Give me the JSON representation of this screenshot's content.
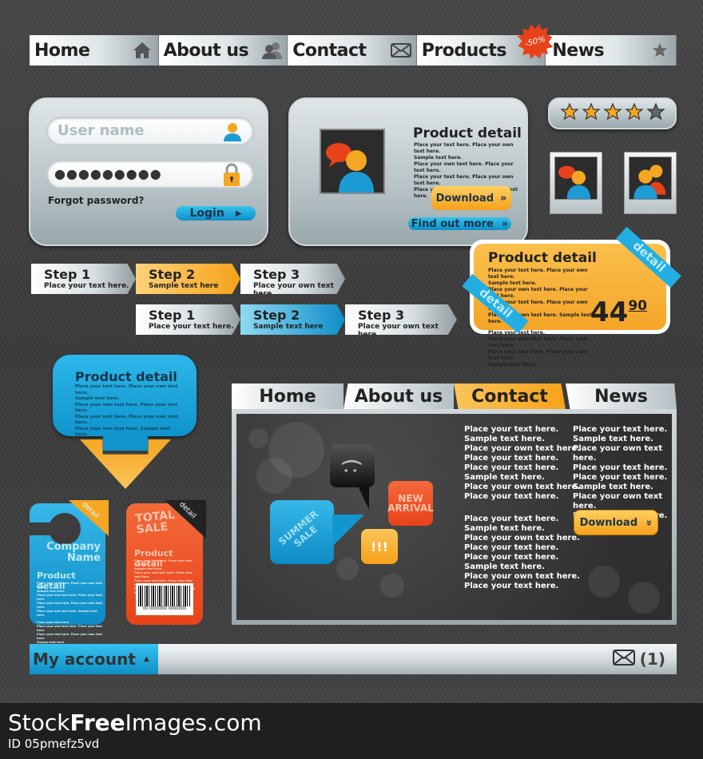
{
  "top_nav": {
    "tabs": [
      {
        "label": "Home",
        "icon": "home-icon"
      },
      {
        "label": "About us",
        "icon": "users-icon"
      },
      {
        "label": "Contact",
        "icon": "envelope-icon"
      },
      {
        "label": "Products",
        "icon": "none"
      },
      {
        "label": "News",
        "icon": "star-icon"
      }
    ],
    "badge": "-50%"
  },
  "login": {
    "username_placeholder": "User name",
    "password_mask": "●●●●●●●●●",
    "forgot_password": "Forgot password?",
    "login_button": "Login"
  },
  "product_card": {
    "title": "Product detail",
    "text_lines": [
      "Place your  text here. Place your own text here.",
      "Sample text here.",
      "Place your own text here. Place your  text here.",
      "Place your  text here. Place your own text here.",
      "Place your own text here. Sample text here."
    ],
    "download_button": "Download",
    "find_out_more_button": "Find out more"
  },
  "rating": {
    "value": 4,
    "max": 5
  },
  "steps_orange": [
    {
      "title": "Step 1",
      "subtitle": "Place your  text here."
    },
    {
      "title": "Step 2",
      "subtitle": "Sample text here"
    },
    {
      "title": "Step 3",
      "subtitle": "Place your own text here."
    }
  ],
  "steps_blue": [
    {
      "title": "Step 1",
      "subtitle": "Place your  text here."
    },
    {
      "title": "Step 2",
      "subtitle": "Sample text here"
    },
    {
      "title": "Step 3",
      "subtitle": "Place your own text here."
    }
  ],
  "price_card": {
    "title": "Product detail",
    "text_lines": [
      "Place your  text here. Place your own text here.",
      "Sample text here.",
      "Place your own text here. Place your  text here.",
      "Place your  text here. Place your own text here.",
      "Place your own text here. Sample text here."
    ],
    "text_lines_2": [
      "Place your  text here.",
      "Place your own text here. Place your  text here.",
      "Place your  text here. Place your own text here.",
      "Sample text here."
    ],
    "price_main": "44",
    "price_cents": "90",
    "ribbon_label": "detail"
  },
  "blue_bubble": {
    "title": "Product detail",
    "text_lines": [
      "Place your  text here. Place your own text here.",
      "Sample text here.",
      "Place your own text here. Place your  text here.",
      "Place your  text here. Place your own text here.",
      "Place your own text here. Sample text here."
    ]
  },
  "door_tag": {
    "company": "Company",
    "name": "Name",
    "title": "Product detail",
    "corner": "detail",
    "text_lines": [
      "Place your  text here. Place your own text here.",
      "Sample text here.",
      "Place your own text here. Place your  text here.",
      "Place your  text here. Place your own text here.",
      "Place your own text here. Sample text here.",
      "",
      "Place your  text here.",
      "Place your own text here. Place your  text here.",
      "Place your  text here. Place your own text here.",
      "Sample text here."
    ]
  },
  "sale_tag": {
    "sale_line1": "TOTAL",
    "sale_line2": "SALE",
    "title": "Product detail",
    "corner": "detail",
    "text_lines": [
      "Place your  text here. Place your own text here.",
      "Sample text here.",
      "Place your own text here. Place your  text here.",
      "Place your  text here. Place your own text here.",
      "Place your own text here. Sample text here."
    ],
    "barcode_number": "00 0000000   0000000"
  },
  "content_box": {
    "tabs": [
      "Home",
      "About us",
      "Contact",
      "News"
    ],
    "active_tab": "Contact",
    "bubbles": {
      "summer": "SUMMER SALE",
      "new": "NEW ARRIVAL",
      "alert": "!!!",
      "smile": "(:"
    },
    "col1_a": [
      "Place your  text here.",
      "Sample text here.",
      "Place your own text here.",
      "Place your  text here.",
      "Place your  text here.",
      "Sample text here.",
      "Place your own text here.",
      "Place your  text here."
    ],
    "col1_b": [
      "Place your  text here.",
      "Sample text here.",
      "Place your own text here.",
      "Place your  text here.",
      "Place your  text here.",
      "Sample text here.",
      "Place your own text here.",
      "Place your  text here."
    ],
    "col2": [
      "Place your  text here.",
      "Sample text here.",
      "Place your own text here.",
      "Place your  text here.",
      "Place your  text here.",
      "Sample text here.",
      "Place your own text here.",
      "Place your  text here."
    ],
    "download_button": "Download"
  },
  "account_bar": {
    "label": "My account",
    "message_count": "(1)"
  },
  "footer": {
    "brand_prefix": "Stock",
    "brand_bold": "Free",
    "brand_suffix": "Images.com",
    "id": "ID 05pmefz5vd"
  },
  "colors": {
    "accent_blue": "#1aa3dc",
    "accent_orange": "#f5a623",
    "sale_red": "#e8421a",
    "bg_dark": "#3f3f3f"
  }
}
